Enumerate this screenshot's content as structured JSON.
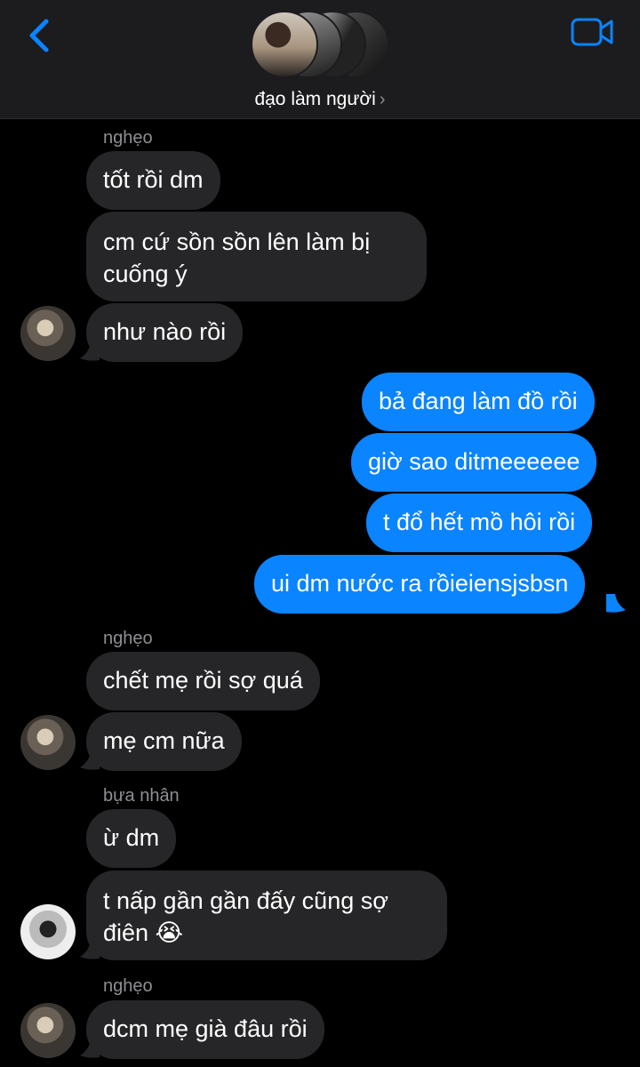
{
  "header": {
    "title": "đạo làm người",
    "chevron": "›",
    "back_icon": "chevron-left-icon",
    "video_icon": "video-camera-icon",
    "accent": "#0a84ff"
  },
  "messages": {
    "s1": "nghẹo",
    "m1": "tốt rồi dm",
    "m2": "cm cứ sồn sồn lên làm bị cuống ý",
    "m3": "như nào rồi",
    "o1": "bả đang làm đồ rồi",
    "o2": "giờ sao ditmeeeeee",
    "o3": "t đổ hết mồ hôi rồi",
    "o4": "ui dm nước ra rồieiensjsbsn",
    "s2": "nghẹo",
    "m4": "chết mẹ rồi sợ quá",
    "m5": "mẹ cm nữa",
    "s3": "bựa nhân",
    "m6": "ừ dm",
    "m7": "t nấp gần gần đấy cũng sợ điên 😭",
    "s4": "nghẹo",
    "m8": "dcm mẹ già đâu rồi"
  },
  "colors": {
    "background": "#000000",
    "header_bg": "#1c1c1e",
    "incoming_bubble": "#262628",
    "outgoing_bubble": "#0a84ff",
    "sender_name": "#8e8e93"
  }
}
